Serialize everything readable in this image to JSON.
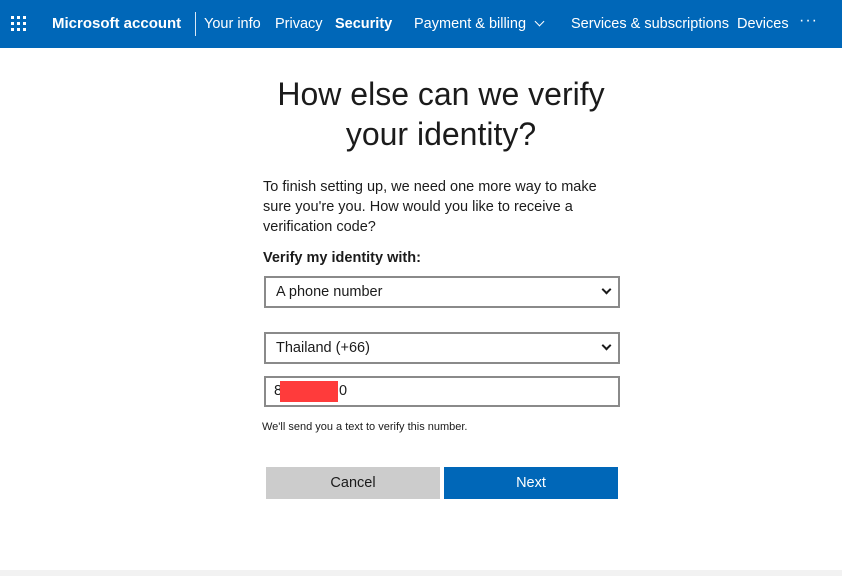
{
  "header": {
    "brand": "Microsoft account",
    "nav": [
      {
        "label": "Your info"
      },
      {
        "label": "Privacy"
      },
      {
        "label": "Security"
      },
      {
        "label": "Payment & billing"
      },
      {
        "label": "Services & subscriptions"
      },
      {
        "label": "Devices"
      }
    ],
    "more_label": "···",
    "accent_color": "#0067b8"
  },
  "main": {
    "title_line1": "How else can we verify",
    "title_line2": "your identity?",
    "description": "To finish setting up, we need one more way to make sure you're you. How would you like to receive a verification code?",
    "verify_label": "Verify my identity with:",
    "method_select": {
      "value": "A phone number"
    },
    "country_select": {
      "value": "Thailand (+66)"
    },
    "phone_input": {
      "prefix": "8",
      "suffix": "0"
    },
    "hint": "We'll send you a text to verify this number.",
    "cancel_label": "Cancel",
    "next_label": "Next"
  }
}
